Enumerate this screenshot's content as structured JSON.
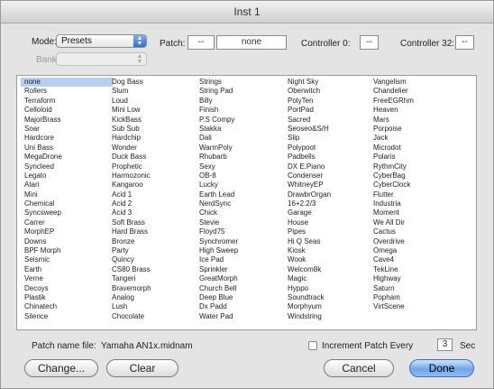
{
  "window": {
    "title": "Inst 1"
  },
  "top": {
    "mode_label": "Mode:",
    "mode_value": "Presets",
    "bank_label": "Bank:",
    "bank_value": "",
    "patch_label": "Patch:",
    "patch_dash": "--",
    "patch_value": "none",
    "controller0_label": "Controller 0:",
    "controller0_value": "--",
    "controller32_label": "Controller 32:",
    "controller32_value": "--"
  },
  "patch_columns": [
    [
      "none",
      "Rollers",
      "Terraform",
      "Celloloid",
      "MajorBrass",
      "Soar",
      "Hardcore",
      "Uni Bass",
      "MegaDrone",
      "Syncleed",
      "Legato",
      "Atari",
      "Mini",
      "Chemical",
      "Syncsweep",
      "Carrer",
      "MorphEP",
      "Downs",
      "BPF Morph",
      "Seismic",
      "Earth",
      "Verne",
      "Decoys",
      "Plastik",
      "Chinatech",
      "Silence"
    ],
    [
      "Dog Bass",
      "Slum",
      "Loud",
      "Mini Low",
      "KickBass",
      "Sub Sub",
      "Hardchip",
      "Wonder",
      "Duck Bass",
      "Prophetic",
      "Harmozonic",
      "Kangaroo",
      "Acid 1",
      "Acid 2",
      "Acid 3",
      "Soft Brass",
      "Hard Brass",
      "Bronze",
      "Party",
      "Quincy",
      "CS80 Brass",
      "Tangeri",
      "Bravemorph",
      "Analog",
      "Lush",
      "Chocolate"
    ],
    [
      "Strings",
      "String Pad",
      "Billy",
      "Finish",
      "P.S Compy",
      "Stakka",
      "Dali",
      "WarmPoly",
      "Rhubarb",
      "Sexy",
      "OB-8",
      "Lucky",
      "Earth Lead",
      "NerdSync",
      "Chick",
      "Stevie",
      "Floyd75",
      "Synchromer",
      "High Sweep",
      "Ice Pad",
      "Sprinkler",
      "GreatMorph",
      "Church Bell",
      "Deep Blue",
      "Dx Padd",
      "Water Pad"
    ],
    [
      "Night Sky",
      "Oberwitch",
      "PolyTen",
      "PortPad",
      "Sacred",
      "Seoseo&S/H",
      "Slip",
      "Polypoot",
      "Padbells",
      "DX E.Piano",
      "Condenser",
      "WhitneyEP",
      "DrawbrOrgan",
      "16+2.2/3",
      "Garage",
      "House",
      "Pipes",
      "Hi Q Seas",
      "Kiosk",
      "Wook",
      "Welcom8k",
      "Magic",
      "Hyppo",
      "Soundtrack",
      "Morphyum",
      "Windstring"
    ],
    [
      "Vangelism",
      "Chandelier",
      "FreeEGRhm",
      "Heaven",
      "Mars",
      "Porpoise",
      "Jack",
      "Microdot",
      "Polaris",
      "RythmCity",
      "CyberBag",
      "CyberClock",
      "Flutter",
      "Industria",
      "Moment",
      "We All Dir",
      "Cactus",
      "Overdrive",
      "Omega",
      "Cave4",
      "TekLine",
      "Highway",
      "Saturn",
      "Popham",
      "VirtScene",
      ""
    ]
  ],
  "selected_patch": "none",
  "bottom": {
    "patch_file_label": "Patch name file:",
    "patch_file_name": "Yamaha AN1x.midnam",
    "increment_label": "Increment Patch Every",
    "increment_value": "3",
    "increment_unit": "Sec",
    "change_button": "Change...",
    "clear_button": "Clear",
    "cancel_button": "Cancel",
    "done_button": "Done"
  }
}
